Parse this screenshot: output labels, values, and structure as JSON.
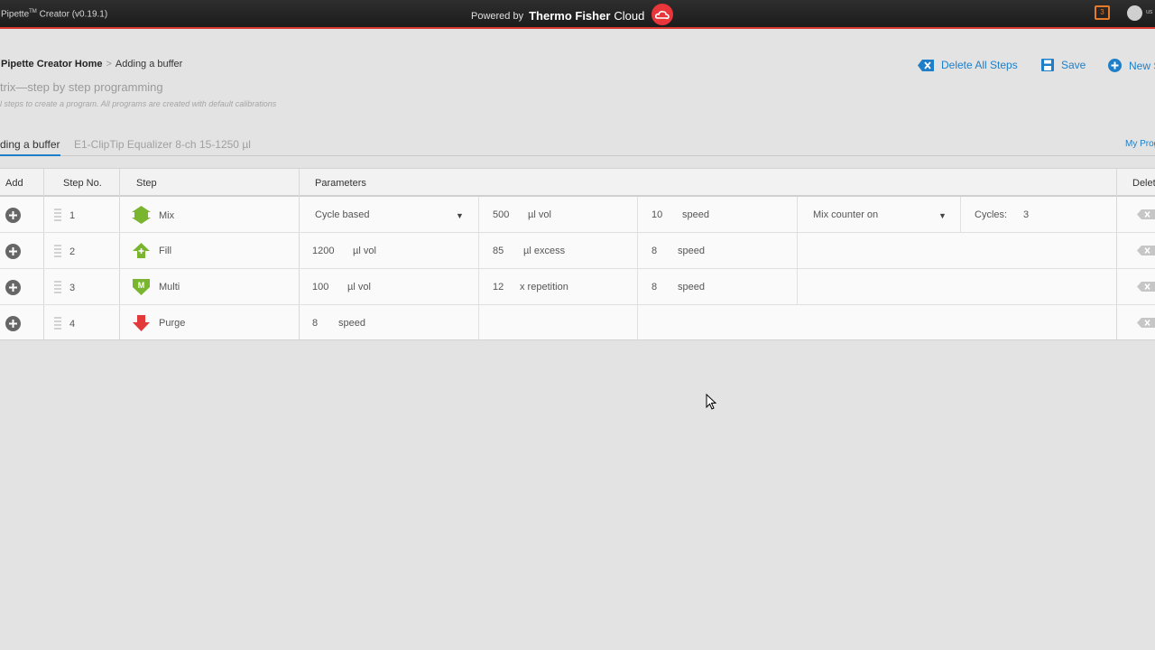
{
  "topbar": {
    "app_name": "Pipette",
    "tm": "TM",
    "app_suffix": "Creator (v0.19.1)",
    "powered_by": "Powered by",
    "brand": "Thermo Fisher",
    "cloud": "Cloud",
    "notification_count": "3",
    "user_label": "us"
  },
  "breadcrumb": {
    "home": "Pipette Creator Home",
    "separator": ">",
    "current": "Adding a buffer"
  },
  "header": {
    "subtitle": "trix—step by step programming",
    "hint": "l steps to create a program. All programs are created with default calibrations"
  },
  "toolbar": {
    "delete_all_label": "Delete All Steps",
    "save_label": "Save",
    "new_label": "New S"
  },
  "tabs": {
    "active": "ding a buffer",
    "description": "E1-ClipTip Equalizer 8-ch 15-1250 µl",
    "right_link": "My Prog"
  },
  "table": {
    "headers": {
      "add": "Add",
      "step_no": "Step No.",
      "step": "Step",
      "parameters": "Parameters",
      "delete": "Delet"
    },
    "rows": [
      {
        "num": "1",
        "step": "Mix",
        "icon": "mix-icon",
        "color": "#7ab530",
        "p1_value": "Cycle based",
        "p1_unit": "",
        "p2_value": "500",
        "p2_unit": "µl vol",
        "p3_value": "10",
        "p3_unit": "speed",
        "p4_value": "Mix counter on",
        "p5_label": "Cycles:",
        "p5_value": "3"
      },
      {
        "num": "2",
        "step": "Fill",
        "icon": "fill-icon",
        "color": "#7ab530",
        "p1_value": "1200",
        "p1_unit": "µl vol",
        "p2_value": "85",
        "p2_unit": "µl excess",
        "p3_value": "8",
        "p3_unit": "speed"
      },
      {
        "num": "3",
        "step": "Multi",
        "icon": "multi-icon",
        "color": "#7ab530",
        "p1_value": "100",
        "p1_unit": "µl vol",
        "p2_value": "12",
        "p2_unit": "x repetition",
        "p3_value": "8",
        "p3_unit": "speed"
      },
      {
        "num": "4",
        "step": "Purge",
        "icon": "purge-icon",
        "color": "#e23a3a",
        "p1_value": "8",
        "p1_unit": "speed"
      }
    ]
  }
}
